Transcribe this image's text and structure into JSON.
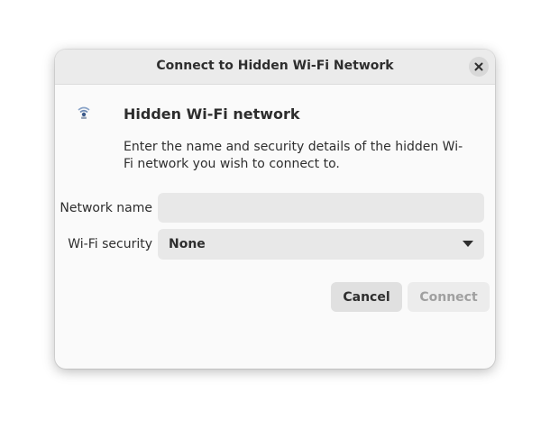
{
  "dialog": {
    "title": "Connect to Hidden Wi-Fi Network",
    "heading": "Hidden Wi-Fi network",
    "description": "Enter the name and security details of the hidden Wi-Fi network you wish to connect to.",
    "icon": "wifi-network-icon"
  },
  "form": {
    "network_name_label": "Network name",
    "network_name_value": "",
    "security_label": "Wi-Fi security",
    "security_value": "None"
  },
  "buttons": {
    "cancel_label": "Cancel",
    "connect_label": "Connect",
    "connect_enabled": false
  },
  "colors": {
    "dialog_bg": "#fafafa",
    "titlebar_bg": "#ebebeb",
    "field_bg": "#e8e8e8",
    "text": "#2e2e2e",
    "disabled_text": "#a0a0a0"
  }
}
